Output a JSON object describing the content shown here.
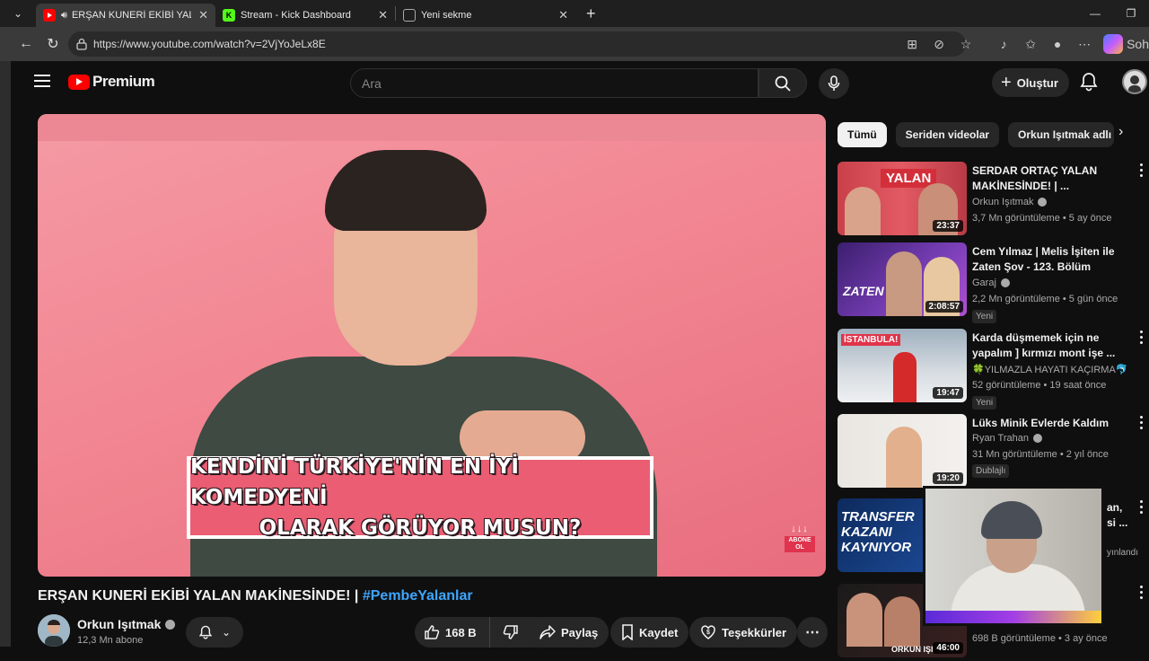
{
  "browser": {
    "tabs": [
      {
        "title": "ERŞAN KUNERİ EKİBİ YALAN MAK",
        "active": true,
        "favicon": "youtube-icon",
        "audio": true
      },
      {
        "title": "Stream - Kick Dashboard",
        "active": false,
        "favicon": "kick-icon"
      },
      {
        "title": "Yeni sekme",
        "active": false,
        "favicon": "newtab-icon"
      }
    ],
    "url": "https://www.youtube.com/watch?v=2VjYoJeLx8E",
    "sidebar_label": "Soh"
  },
  "header": {
    "brand": "Premium",
    "search_placeholder": "Ara",
    "create_label": "Oluştur"
  },
  "video": {
    "caption_line1": "KENDİNİ TÜRKİYE'NİN EN İYİ KOMEDYENİ",
    "caption_line2": "OLARAK GÖRÜYOR MUSUN?",
    "abone_label": "ABONE OL",
    "title": "ERŞAN KUNERİ EKİBİ YALAN MAKİNESİNDE! |",
    "hashtag": "#PembeYalanlar",
    "channel": "Orkun Işıtmak",
    "subscribers": "12,3 Mn abone",
    "likes": "168 B",
    "share_label": "Paylaş",
    "save_label": "Kaydet",
    "thanks_label": "Teşekkürler"
  },
  "chips": [
    "Tümü",
    "Seriden videolar",
    "Orkun Işıtmak adlı yü"
  ],
  "related": [
    {
      "title": "SERDAR ORTAÇ YALAN MAKİNESİNDE! | ...",
      "channel": "Orkun Işıtmak",
      "verified": true,
      "meta": "3,7 Mn görüntüleme • 5 ay önce",
      "duration": "23:37",
      "badge": "",
      "thumb_text": "YALAN"
    },
    {
      "title": "Cem Yılmaz | Melis İşiten ile Zaten Şov - 123. Bölüm",
      "channel": "Garaj",
      "verified": true,
      "meta": "2,2 Mn görüntüleme • 5 gün önce",
      "duration": "2:08:57",
      "badge": "Yeni",
      "thumb_text": "ZATEN"
    },
    {
      "title": "Karda düşmemek için ne yapalım ] kırmızı mont işe ...",
      "channel": "🍀YILMAZLA HAYATI KAÇIRMA🐬",
      "verified": false,
      "meta": "52 görüntüleme • 19 saat önce",
      "duration": "19:47",
      "badge": "Yeni",
      "thumb_text": "İSTANBULA!"
    },
    {
      "title": "Lüks Minik Evlerde Kaldım",
      "channel": "Ryan Trahan",
      "verified": true,
      "meta": "31 Mn görüntüleme • 2 yıl önce",
      "duration": "19:20",
      "badge": "Dublajlı",
      "thumb_text": ""
    },
    {
      "title": "an, si ...",
      "channel": "",
      "verified": false,
      "meta": "",
      "duration": "",
      "badge": "",
      "thumb_text": "TRANSFER KAZANI KAYNIYOR",
      "extra": "yınlandı"
    },
    {
      "title": "",
      "channel": "",
      "verified": false,
      "meta": "698 B görüntüleme • 3 ay önce",
      "duration": "46:00",
      "badge": "",
      "thumb_text": "ORKUN IŞI"
    }
  ],
  "colors": {
    "accent": "#ff0000",
    "link": "#3ea6ff",
    "caption_bg": "#ea5d72"
  }
}
